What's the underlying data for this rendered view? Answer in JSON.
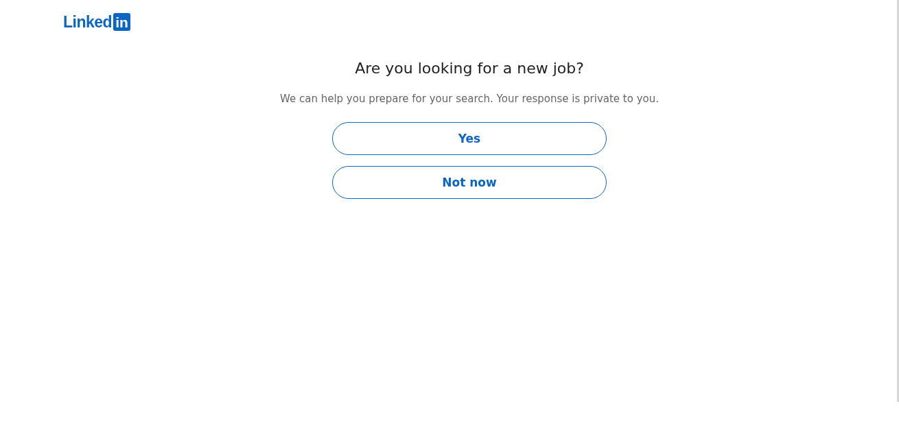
{
  "logo": {
    "wordmark": "Linked",
    "badge": "in"
  },
  "title": "Are you looking for a new job?",
  "subtitle": "We can help you prepare for your search. Your response is private to you.",
  "buttons": [
    {
      "label": "Yes"
    },
    {
      "label": "Not now"
    }
  ]
}
